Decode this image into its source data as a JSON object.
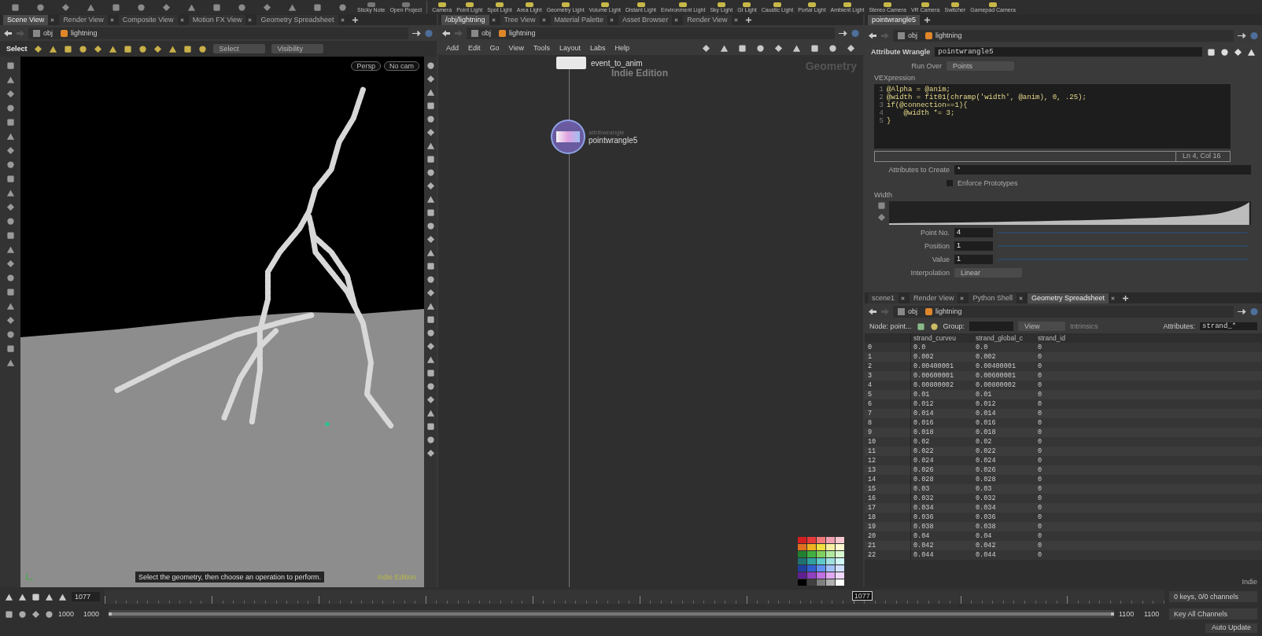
{
  "shelf": {
    "tools": [
      {
        "label": "Sticky Note"
      },
      {
        "label": "Open Project"
      }
    ],
    "light_tools": [
      {
        "label": "Camera"
      },
      {
        "label": "Point Light"
      },
      {
        "label": "Spot Light"
      },
      {
        "label": "Area Light"
      },
      {
        "label": "Geometry Light"
      },
      {
        "label": "Volume Light"
      },
      {
        "label": "Distant Light"
      },
      {
        "label": "Environment Light"
      },
      {
        "label": "Sky Light"
      },
      {
        "label": "GI Light"
      },
      {
        "label": "Caustic Light"
      },
      {
        "label": "Portal Light"
      },
      {
        "label": "Ambient Light"
      },
      {
        "label": "Stereo Camera"
      },
      {
        "label": "VR Camera"
      },
      {
        "label": "Switcher"
      },
      {
        "label": "Gamepad Camera"
      }
    ]
  },
  "scene_pane": {
    "tabs": [
      {
        "label": "Scene View",
        "selected": true
      },
      {
        "label": "Render View",
        "selected": false
      },
      {
        "label": "Composite View",
        "selected": false
      },
      {
        "label": "Motion FX View",
        "selected": false
      },
      {
        "label": "Geometry Spreadsheet",
        "selected": false
      }
    ],
    "path": [
      "obj",
      "lightning"
    ],
    "select_label": "Select",
    "select_mode": "Select",
    "visibility": "Visibility",
    "view_buttons": [
      "Persp",
      "No cam"
    ],
    "status": "Select the geometry, then choose an operation to perform.",
    "edition": "Indie Edition"
  },
  "network_pane": {
    "tabs": [
      {
        "label": "/obj/lightning",
        "selected": true
      },
      {
        "label": "Tree View",
        "selected": false
      },
      {
        "label": "Material Palette",
        "selected": false
      },
      {
        "label": "Asset Browser",
        "selected": false
      },
      {
        "label": "Render View",
        "selected": false
      }
    ],
    "path": [
      "obj",
      "lightning"
    ],
    "menu": [
      "Add",
      "Edit",
      "Go",
      "View",
      "Tools",
      "Layout",
      "Labs",
      "Help"
    ],
    "edition": "Indie Edition",
    "context": "Geometry",
    "nodes": [
      {
        "kind": "box",
        "name": "event_to_anim",
        "selected": false
      },
      {
        "kind": "wrangle",
        "subtitle": "attribwrangle",
        "name": "pointwrangle5",
        "selected": true
      }
    ],
    "palette": [
      {
        "color": "#d42020"
      },
      {
        "color": "#e83a3a"
      },
      {
        "color": "#f07a7a"
      },
      {
        "color": "#f0a0b0"
      },
      {
        "color": "#f8c8d0"
      },
      {
        "color": "#e07020"
      },
      {
        "color": "#f0b020"
      },
      {
        "color": "#f0e040"
      },
      {
        "color": "#f8f0a0"
      },
      {
        "color": "#fff8d0"
      },
      {
        "color": "#208030"
      },
      {
        "color": "#40b040"
      },
      {
        "color": "#80d060"
      },
      {
        "color": "#b0e8a0"
      },
      {
        "color": "#d8f8d0"
      },
      {
        "color": "#207070"
      },
      {
        "color": "#30a0a0"
      },
      {
        "color": "#60c8c8"
      },
      {
        "color": "#a0e0e0"
      },
      {
        "color": "#d0f8f8"
      },
      {
        "color": "#2040a0"
      },
      {
        "color": "#3060d0"
      },
      {
        "color": "#6090f0"
      },
      {
        "color": "#a0c0f8"
      },
      {
        "color": "#d0e0ff"
      },
      {
        "color": "#602090"
      },
      {
        "color": "#9040c0"
      },
      {
        "color": "#c070e0"
      },
      {
        "color": "#e0a8f0"
      },
      {
        "color": "#f0d8ff"
      },
      {
        "color": "#000000"
      },
      {
        "color": "#404040"
      },
      {
        "color": "#808080"
      },
      {
        "color": "#b0b0b0"
      },
      {
        "color": "#ffffff"
      }
    ]
  },
  "parameter_pane": {
    "tab": "pointwrangle5",
    "path": [
      "obj",
      "lightning"
    ],
    "node_type": "Attribute Wrangle",
    "node_name": "pointwrangle5",
    "run_over_label": "Run Over",
    "run_over": "Points",
    "code_label": "VEXpression",
    "code": [
      {
        "number": "1",
        "text": "@Alpha = @anim;"
      },
      {
        "number": "2",
        "text": "@width = fit01(chramp('width', @anim), 0, .25);"
      },
      {
        "number": "3",
        "text": "if(@connection==1){"
      },
      {
        "number": "4",
        "text": "    @width *= 3;"
      },
      {
        "number": "5",
        "text": "}"
      }
    ],
    "cursor": "Ln 4, Col 16",
    "attrs_label": "Attributes to Create",
    "attrs_value": "*",
    "enforce": {
      "label": "Enforce Prototypes",
      "checked": false
    },
    "ramp_label": "Width",
    "ramp_fields": [
      {
        "label": "Point No.",
        "value": "4"
      },
      {
        "label": "Position",
        "value": "1"
      },
      {
        "label": "Value",
        "value": "1"
      }
    ],
    "interp_label": "Interpolation",
    "interp": "Linear"
  },
  "spreadsheet_pane": {
    "tabs": [
      {
        "label": "scene1",
        "selected": false
      },
      {
        "label": "Render View",
        "selected": false
      },
      {
        "label": "Python Shell",
        "selected": false
      },
      {
        "label": "Geometry Spreadsheet",
        "selected": true
      }
    ],
    "path": [
      "obj",
      "lightning"
    ],
    "node_label": "Node: point...",
    "group_label": "Group:",
    "view": "View",
    "intrinsics": {
      "label": "Intrinsics",
      "disabled": true
    },
    "attributes_label": "Attributes:",
    "attributes": "strand_*",
    "columns": [
      "strand_curveu",
      "strand_global_c",
      "strand_id"
    ],
    "rows": [
      {
        "index": "0",
        "cells": [
          "0.0",
          "0.0",
          "0"
        ]
      },
      {
        "index": "1",
        "cells": [
          "0.002",
          "0.002",
          "0"
        ]
      },
      {
        "index": "2",
        "cells": [
          "0.00400001",
          "0.00400001",
          "0"
        ]
      },
      {
        "index": "3",
        "cells": [
          "0.00600001",
          "0.00600001",
          "0"
        ]
      },
      {
        "index": "4",
        "cells": [
          "0.00800002",
          "0.00800002",
          "0"
        ]
      },
      {
        "index": "5",
        "cells": [
          "0.01",
          "0.01",
          "0"
        ]
      },
      {
        "index": "6",
        "cells": [
          "0.012",
          "0.012",
          "0"
        ]
      },
      {
        "index": "7",
        "cells": [
          "0.014",
          "0.014",
          "0"
        ]
      },
      {
        "index": "8",
        "cells": [
          "0.016",
          "0.016",
          "0"
        ]
      },
      {
        "index": "9",
        "cells": [
          "0.018",
          "0.018",
          "0"
        ]
      },
      {
        "index": "10",
        "cells": [
          "0.02",
          "0.02",
          "0"
        ]
      },
      {
        "index": "11",
        "cells": [
          "0.022",
          "0.022",
          "0"
        ]
      },
      {
        "index": "12",
        "cells": [
          "0.024",
          "0.024",
          "0"
        ]
      },
      {
        "index": "13",
        "cells": [
          "0.026",
          "0.026",
          "0"
        ]
      },
      {
        "index": "14",
        "cells": [
          "0.028",
          "0.028",
          "0"
        ]
      },
      {
        "index": "15",
        "cells": [
          "0.03",
          "0.03",
          "0"
        ]
      },
      {
        "index": "16",
        "cells": [
          "0.032",
          "0.032",
          "0"
        ]
      },
      {
        "index": "17",
        "cells": [
          "0.034",
          "0.034",
          "0"
        ]
      },
      {
        "index": "18",
        "cells": [
          "0.036",
          "0.036",
          "0"
        ]
      },
      {
        "index": "19",
        "cells": [
          "0.038",
          "0.038",
          "0"
        ]
      },
      {
        "index": "20",
        "cells": [
          "0.04",
          "0.04",
          "0"
        ]
      },
      {
        "index": "21",
        "cells": [
          "0.042",
          "0.042",
          "0"
        ]
      },
      {
        "index": "22",
        "cells": [
          "0.044",
          "0.044",
          "0"
        ]
      }
    ],
    "edition": "Indie"
  },
  "timeline": {
    "frame": "1077",
    "marker": "1077",
    "start": "1000",
    "range_start": "1000",
    "range_end": "1100",
    "range": {
      "level": 1
    },
    "end": "1100",
    "keys": "0 keys, 0/0 channels",
    "key_all": "Key All Channels",
    "auto_update": "Auto Update"
  }
}
